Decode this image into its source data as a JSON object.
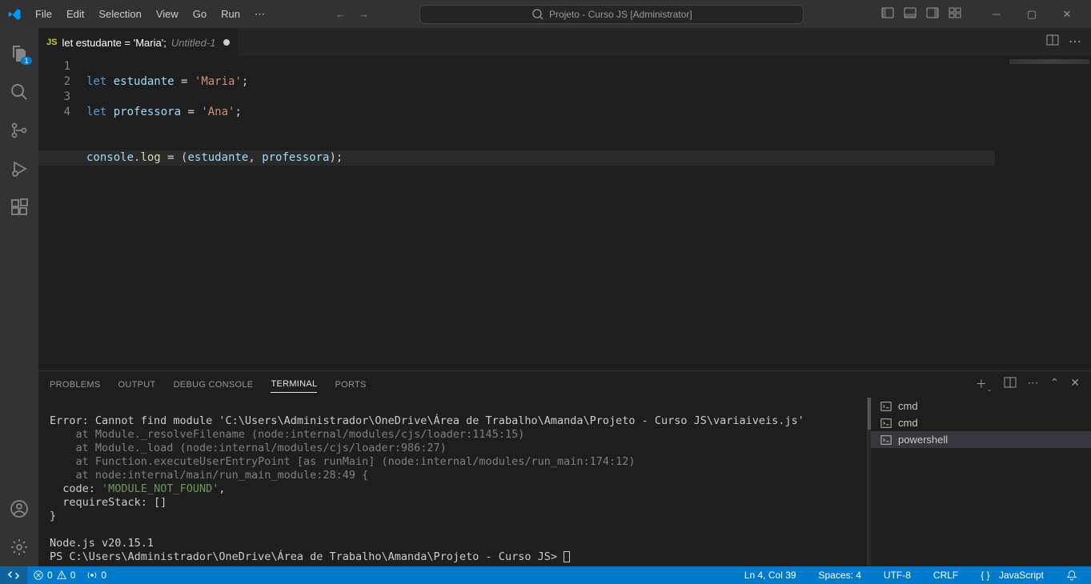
{
  "titlebar": {
    "menus": [
      "File",
      "Edit",
      "Selection",
      "View",
      "Go",
      "Run"
    ],
    "search_label": "Projeto - Curso JS [Administrator]"
  },
  "activitybar": {
    "explorer_badge": "1"
  },
  "editor": {
    "tab": {
      "icon_label": "JS",
      "title": "let estudante = 'Maria';",
      "subtitle": "Untitled-1"
    },
    "gutter": [
      "1",
      "2",
      "3",
      "4"
    ],
    "code": {
      "l1": {
        "kw": "let",
        "var": "estudante",
        "op1": " = ",
        "str": "'Maria'",
        "op2": ";"
      },
      "l2": {
        "kw": "let",
        "var": "professora",
        "op1": " = ",
        "str": "'Ana'",
        "op2": ";"
      },
      "l3": "",
      "l4": {
        "obj": "console",
        "dot": ".",
        "fn": "log",
        "op1": " = (",
        "v1": "estudante",
        "comma": ", ",
        "v2": "professora",
        "op2": ");"
      }
    }
  },
  "panel": {
    "tabs": {
      "problems": "PROBLEMS",
      "output": "OUTPUT",
      "debug": "DEBUG CONSOLE",
      "terminal": "TERMINAL",
      "ports": "PORTS"
    },
    "terminal": {
      "line1": "Error: Cannot find module 'C:\\Users\\Administrador\\OneDrive\\Área de Trabalho\\Amanda\\Projeto - Curso JS\\variaiveis.js'",
      "line2": "    at Module._resolveFilename (node:internal/modules/cjs/loader:1145:15)",
      "line3": "    at Module._load (node:internal/modules/cjs/loader:986:27)",
      "line4": "    at Function.executeUserEntryPoint [as runMain] (node:internal/modules/run_main:174:12)",
      "line5": "    at node:internal/main/run_main_module:28:49 {",
      "line6a": "  code: ",
      "line6b": "'MODULE_NOT_FOUND'",
      "line6c": ",",
      "line7": "  requireStack: []",
      "line8": "}",
      "line9": "",
      "line10": "Node.js v20.15.1",
      "line11": "PS C:\\Users\\Administrador\\OneDrive\\Área de Trabalho\\Amanda\\Projeto - Curso JS> "
    },
    "term_list": {
      "cmd1": "cmd",
      "cmd2": "cmd",
      "ps": "powershell"
    }
  },
  "statusbar": {
    "errors": "0",
    "warnings": "0",
    "ports": "0",
    "position": "Ln 4, Col 39",
    "spaces": "Spaces: 4",
    "encoding": "UTF-8",
    "eol": "CRLF",
    "lang_braces": "{ }",
    "language": "JavaScript"
  }
}
